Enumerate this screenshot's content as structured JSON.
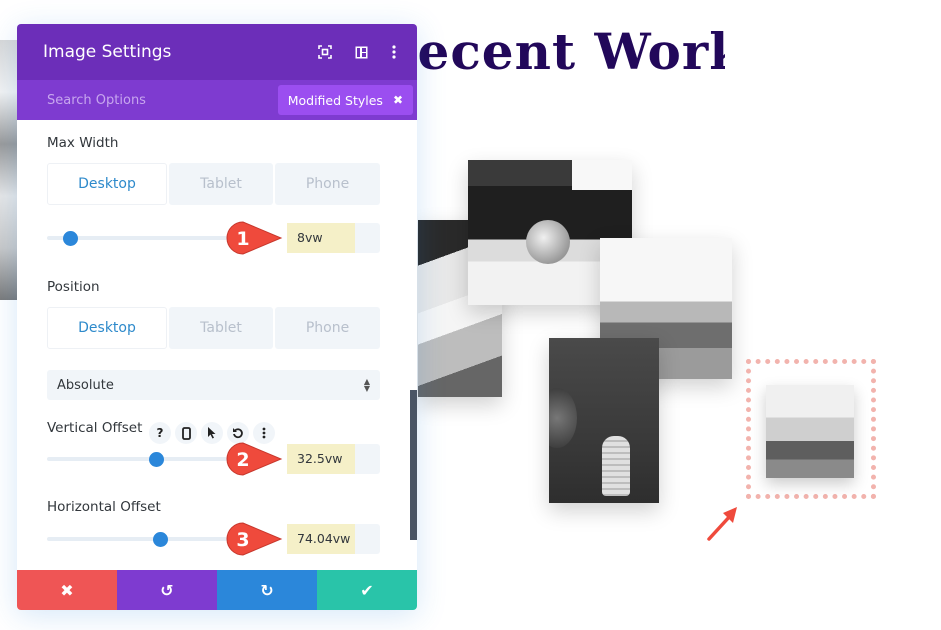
{
  "page": {
    "heading": "Recent Work",
    "heading_visible": "cent Work"
  },
  "panel": {
    "title": "Image Settings",
    "header_icons": [
      "fullscreen-icon",
      "sidebar-layout-icon",
      "more-options-icon"
    ],
    "search_placeholder": "Search Options",
    "modified_styles_label": "Modified Styles",
    "modified_styles_close": "✖",
    "fields": {
      "max_width": {
        "label": "Max Width",
        "tabs": [
          "Desktop",
          "Tablet",
          "Phone"
        ],
        "active_tab": "Desktop",
        "value": "8vw",
        "callout": "1"
      },
      "position": {
        "label": "Position",
        "tabs": [
          "Desktop",
          "Tablet",
          "Phone"
        ],
        "active_tab": "Desktop",
        "select_value": "Absolute"
      },
      "vertical_offset": {
        "label": "Vertical Offset",
        "option_icons": [
          "help-icon",
          "responsive-phone-icon",
          "hover-cursor-icon",
          "reset-icon",
          "more-icon"
        ],
        "help_glyph": "?",
        "value": "32.5vw",
        "callout": "2"
      },
      "horizontal_offset": {
        "label": "Horizontal Offset",
        "value": "74.04vw",
        "callout": "3"
      }
    },
    "footer": {
      "discard_glyph": "✖",
      "undo_glyph": "↺",
      "redo_glyph": "↻",
      "save_glyph": "✔"
    }
  },
  "colors": {
    "header": "#6c2eb9",
    "subbar": "#7e3bd0",
    "accent_blue": "#2b87da",
    "discard": "#ef5555",
    "undo": "#7e3bd0",
    "redo": "#2b87da",
    "save": "#29c4a9",
    "callout": "#ef4a3c",
    "heading": "#22085a"
  }
}
